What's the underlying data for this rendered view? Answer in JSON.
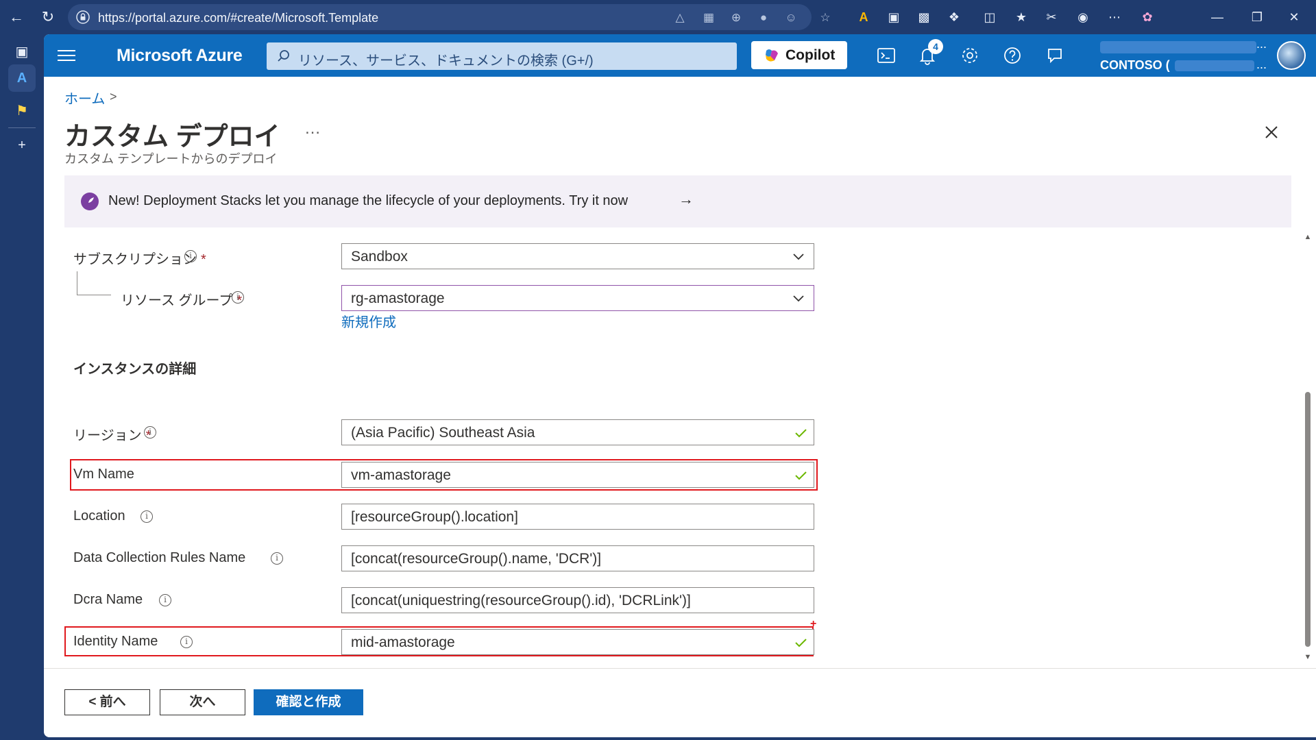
{
  "browser": {
    "url": "https://portal.azure.com/#create/Microsoft.Template"
  },
  "portal": {
    "brand": "Microsoft Azure",
    "search_placeholder": "リソース、サービス、ドキュメントの検索 (G+/)",
    "copilot_label": "Copilot",
    "notification_count": "4",
    "tenant_label": "CONTOSO (",
    "account_dots": "...",
    "colors": {
      "nav": "#0f6cbd",
      "browser": "#1f3b6e",
      "highlight": "#e0181d"
    }
  },
  "breadcrumb": {
    "home": "ホーム"
  },
  "page": {
    "title": "カスタム デプロイ",
    "more": "…",
    "subtitle": "カスタム テンプレートからのデプロイ"
  },
  "banner": {
    "text": "New! Deployment Stacks let you manage the lifecycle of your deployments. Try it now",
    "arrow": "→"
  },
  "form": {
    "subscription": {
      "label": "サブスクリプション",
      "required": "*",
      "value": "Sandbox"
    },
    "resource_group": {
      "label": "リソース グループ",
      "required": "*",
      "value": "rg-amastorage",
      "new_link": "新規作成"
    },
    "section_instance": "インスタンスの詳細",
    "region": {
      "label": "リージョン",
      "required": "*",
      "value": "(Asia Pacific) Southeast Asia"
    },
    "vm_name": {
      "label": "Vm Name",
      "value": "vm-amastorage"
    },
    "location": {
      "label": "Location",
      "value": "[resourceGroup().location]"
    },
    "dcr_name": {
      "label": "Data Collection Rules Name",
      "value": "[concat(resourceGroup().name, 'DCR')]"
    },
    "dcra_name": {
      "label": "Dcra Name",
      "value": "[concat(uniquestring(resourceGroup().id), 'DCRLink')]"
    },
    "identity_name": {
      "label": "Identity Name",
      "value": "mid-amastorage"
    }
  },
  "footer": {
    "prev": "< 前へ",
    "next": "次へ",
    "review_create": "確認と作成"
  }
}
